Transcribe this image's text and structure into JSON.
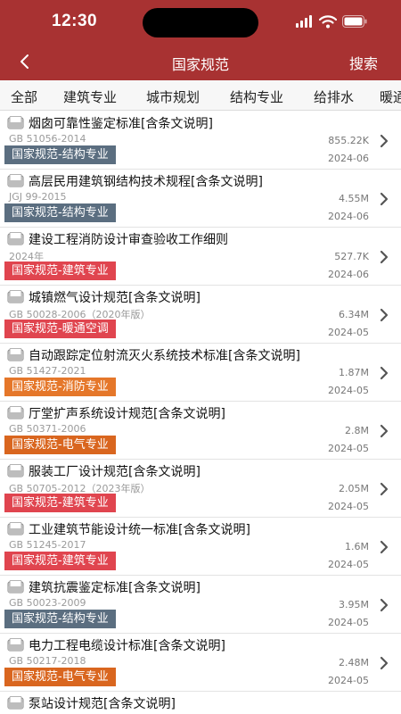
{
  "status": {
    "time": "12:30"
  },
  "nav": {
    "title": "国家规范",
    "search_label": "搜索"
  },
  "tabs": [
    "全部",
    "建筑专业",
    "城市规划",
    "结构专业",
    "给排水",
    "暖通"
  ],
  "colors": {
    "header": "#a83232",
    "tag_structure": "#5b6e80",
    "tag_architecture": "#e0454f",
    "tag_hvac": "#e0454f",
    "tag_fire": "#e5772a",
    "tag_electrical": "#d9661f"
  },
  "items": [
    {
      "title": "烟囱可靠性鉴定标准[含条文说明]",
      "code": "GB 51056-2014",
      "tag": "国家规范-结构专业",
      "tag_color": "#5b6e80",
      "size": "855.22K",
      "date": "2024-06"
    },
    {
      "title": "高层民用建筑钢结构技术规程[含条文说明]",
      "code": "JGJ 99-2015",
      "tag": "国家规范-结构专业",
      "tag_color": "#5b6e80",
      "size": "4.55M",
      "date": "2024-06"
    },
    {
      "title": "建设工程消防设计审查验收工作细则",
      "code": "2024年",
      "tag": "国家规范-建筑专业",
      "tag_color": "#e0454f",
      "size": "527.7K",
      "date": "2024-06"
    },
    {
      "title": "城镇燃气设计规范[含条文说明]",
      "code": "GB 50028-2006（2020年版）",
      "tag": "国家规范-暖通空调",
      "tag_color": "#e0454f",
      "size": "6.34M",
      "date": "2024-05"
    },
    {
      "title": "自动跟踪定位射流灭火系统技术标准[含条文说明]",
      "code": "GB 51427-2021",
      "tag": "国家规范-消防专业",
      "tag_color": "#e5772a",
      "size": "1.87M",
      "date": "2024-05"
    },
    {
      "title": "厅堂扩声系统设计规范[含条文说明]",
      "code": "GB 50371-2006",
      "tag": "国家规范-电气专业",
      "tag_color": "#d9661f",
      "size": "2.8M",
      "date": "2024-05"
    },
    {
      "title": "服装工厂设计规范[含条文说明]",
      "code": "GB 50705-2012（2023年版）",
      "tag": "国家规范-建筑专业",
      "tag_color": "#e0454f",
      "size": "2.05M",
      "date": "2024-05"
    },
    {
      "title": "工业建筑节能设计统一标准[含条文说明]",
      "code": "GB 51245-2017",
      "tag": "国家规范-建筑专业",
      "tag_color": "#e0454f",
      "size": "1.6M",
      "date": "2024-05"
    },
    {
      "title": "建筑抗震鉴定标准[含条文说明]",
      "code": "GB 50023-2009",
      "tag": "国家规范-结构专业",
      "tag_color": "#5b6e80",
      "size": "3.95M",
      "date": "2024-05"
    },
    {
      "title": "电力工程电缆设计标准[含条文说明]",
      "code": "GB 50217-2018",
      "tag": "国家规范-电气专业",
      "tag_color": "#d9661f",
      "size": "2.48M",
      "date": "2024-05"
    },
    {
      "title": "泵站设计规范[含条文说明]",
      "code": "",
      "tag": "",
      "tag_color": "",
      "size": "",
      "date": ""
    }
  ],
  "icons": {
    "back": "chevron-left-icon",
    "wifi": "wifi-icon",
    "battery": "battery-icon",
    "signal": "signal-icon",
    "doc": "document-icon",
    "chevron": "chevron-right-icon"
  }
}
